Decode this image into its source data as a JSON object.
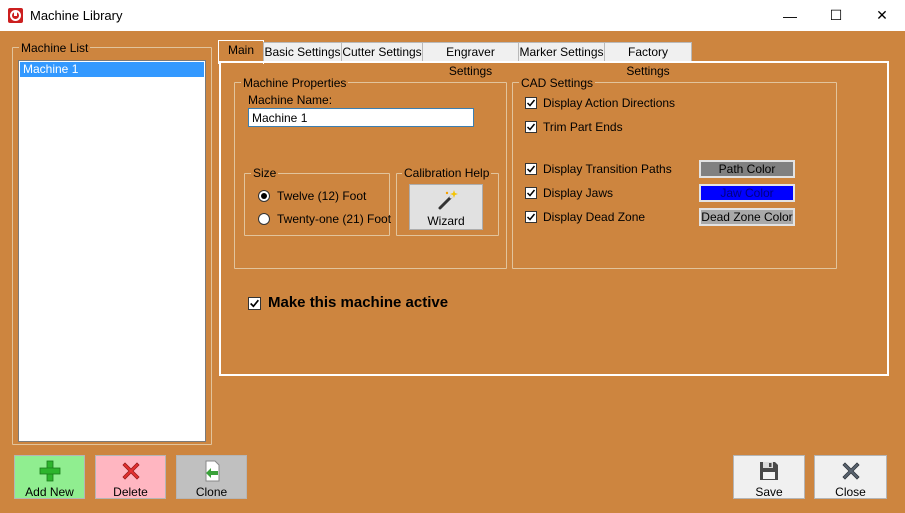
{
  "window": {
    "title": "Machine Library",
    "controls": {
      "minimize": "—",
      "maximize": "☐",
      "close": "✕"
    }
  },
  "machine_list": {
    "label": "Machine List",
    "items": [
      {
        "label": "Machine 1",
        "selected": true
      }
    ]
  },
  "tabs": [
    {
      "label": "Main",
      "active": true
    },
    {
      "label": "Basic Settings"
    },
    {
      "label": "Cutter Settings"
    },
    {
      "label": "Engraver Settings"
    },
    {
      "label": "Marker Settings"
    },
    {
      "label": "Factory Settings"
    }
  ],
  "machine_properties": {
    "label": "Machine Properties",
    "name_label": "Machine Name:",
    "name_value": "Machine 1",
    "size": {
      "label": "Size",
      "options": [
        {
          "label": "Twelve (12) Foot",
          "checked": true
        },
        {
          "label": "Twenty-one (21) Foot",
          "checked": false
        }
      ]
    },
    "calibration": {
      "label": "Calibration Help",
      "wizard_label": "Wizard",
      "icon": "magic-wand-icon"
    }
  },
  "cad_settings": {
    "label": "CAD Settings",
    "options": [
      {
        "label": "Display Action Directions",
        "checked": true
      },
      {
        "label": "Trim Part Ends",
        "checked": true
      },
      {
        "label": "Display Transition Paths",
        "checked": true
      },
      {
        "label": "Display Jaws",
        "checked": true
      },
      {
        "label": "Display Dead Zone",
        "checked": true
      }
    ],
    "color_buttons": [
      {
        "label": "Path Color",
        "color": "#808080",
        "text_color": "#000000"
      },
      {
        "label": "Jaw Color",
        "color": "#0000ff",
        "text_color": "#000080"
      },
      {
        "label": "Dead Zone Color",
        "color": "#a9a9a9",
        "text_color": "#000000"
      }
    ]
  },
  "make_active": {
    "label": "Make this machine active",
    "checked": true
  },
  "buttons": {
    "add_new": {
      "label": "Add New",
      "color": "#90ee90",
      "icon": "plus-icon"
    },
    "delete": {
      "label": "Delete",
      "color": "#ffb6c1",
      "icon": "x-icon"
    },
    "clone": {
      "label": "Clone",
      "color": "#c0c0c0",
      "icon": "clone-icon"
    },
    "save": {
      "label": "Save",
      "color": "#f0f0f0",
      "icon": "floppy-disk-icon"
    },
    "close": {
      "label": "Close",
      "color": "#f0f0f0",
      "icon": "close-x-icon"
    }
  },
  "colors": {
    "background": "#cd853f",
    "selection": "#3399ff"
  }
}
